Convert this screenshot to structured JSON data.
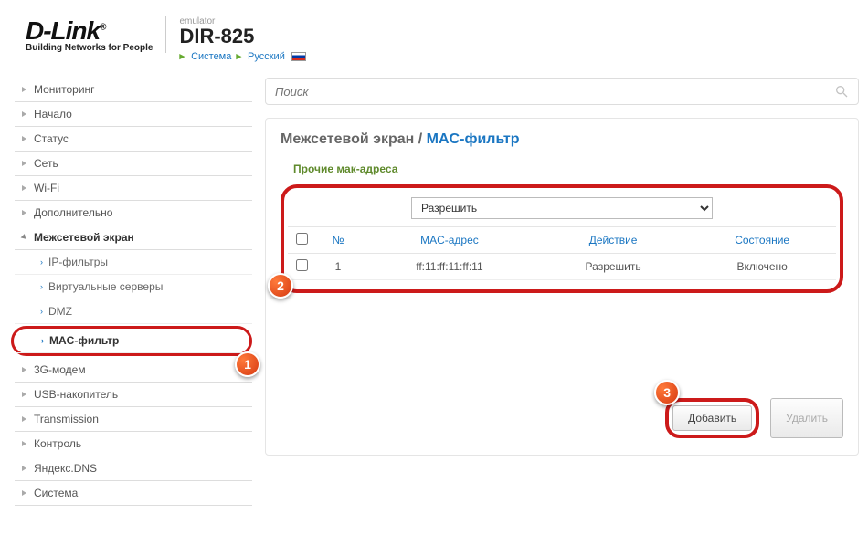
{
  "header": {
    "brand": "D-Link",
    "tagline": "Building Networks for People",
    "emulator_label": "emulator",
    "model": "DIR-825",
    "breadcrumb": {
      "system": "Система",
      "language": "Русский"
    }
  },
  "sidebar": {
    "items": [
      {
        "label": "Мониторинг"
      },
      {
        "label": "Начало"
      },
      {
        "label": "Статус"
      },
      {
        "label": "Сеть"
      },
      {
        "label": "Wi-Fi"
      },
      {
        "label": "Дополнительно"
      },
      {
        "label": "Межсетевой экран",
        "expanded": true,
        "children": [
          {
            "label": "IP-фильтры"
          },
          {
            "label": "Виртуальные серверы"
          },
          {
            "label": "DMZ"
          },
          {
            "label": "MAC-фильтр",
            "active": true
          }
        ]
      },
      {
        "label": "3G-модем"
      },
      {
        "label": "USB-накопитель"
      },
      {
        "label": "Transmission"
      },
      {
        "label": "Контроль"
      },
      {
        "label": "Яндекс.DNS"
      },
      {
        "label": "Система"
      }
    ]
  },
  "search": {
    "placeholder": "Поиск"
  },
  "page": {
    "title_prefix": "Межсетевой экран /",
    "title_main": "MAC-фильтр",
    "section": "Прочие мак-адреса",
    "dropdown_selected": "Разрешить",
    "table": {
      "headers": {
        "num": "№",
        "mac": "MAC-адрес",
        "action": "Действие",
        "state": "Состояние"
      },
      "rows": [
        {
          "num": "1",
          "mac": "ff:11:ff:11:ff:11",
          "action": "Разрешить",
          "state": "Включено"
        }
      ]
    },
    "buttons": {
      "add": "Добавить",
      "delete": "Удалить"
    }
  },
  "annotations": {
    "b1": "1",
    "b2": "2",
    "b3": "3"
  }
}
